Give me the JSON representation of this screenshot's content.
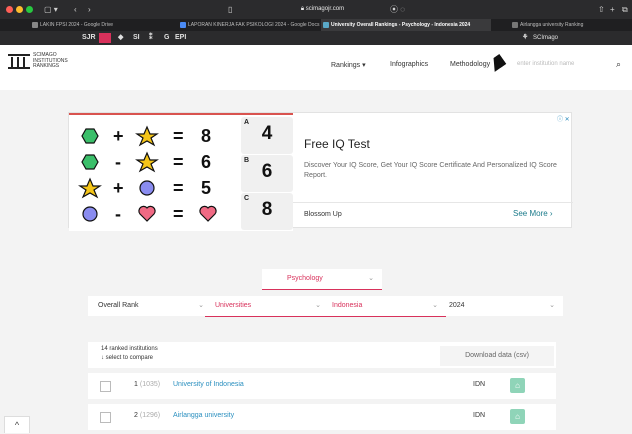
{
  "browser": {
    "address": "scimagojr.com",
    "tabs": [
      {
        "label": "LAKIN FPSI 2024 - Google Drive"
      },
      {
        "label": "LAPORAN KINERJA FAK PSIKOLOGI 2024 - Google Docs"
      },
      {
        "label": "University Overall Rankings - Psychology - Indonesia 2024"
      },
      {
        "label": "Airlangga university Ranking"
      }
    ],
    "bookmarks": [
      "SJR",
      "SI",
      "EPI"
    ],
    "right_bookmark": "SCImago",
    "colors": {
      "close": "#ff5f57",
      "min": "#febc2e",
      "max": "#28c840"
    }
  },
  "site": {
    "logo_lines": [
      "SCIMAGO",
      "INSTITUTIONS",
      "RANKINGS"
    ],
    "nav": {
      "rankings": "Rankings ▾",
      "infographics": "Infographics",
      "methodology": "Methodology"
    },
    "search_placeholder": "enter institution name",
    "accent": "#d8315b"
  },
  "ad": {
    "title": "Free IQ Test",
    "description": "Discover Your IQ Score, Get Your IQ Score Certificate And Personalized IQ Score Report.",
    "brand": "Blossom Up",
    "cta": "See More ›",
    "badge": "ⓘ ✕",
    "puzzle": {
      "rows": [
        {
          "a": "hexagon",
          "op": "+",
          "b": "star",
          "eq": "=",
          "result": "8"
        },
        {
          "a": "hexagon",
          "op": "-",
          "b": "star",
          "eq": "=",
          "result": "6"
        },
        {
          "a": "star",
          "op": "+",
          "b": "circle",
          "eq": "=",
          "result": "5"
        },
        {
          "a": "circle",
          "op": "-",
          "b": "heart",
          "eq": "=",
          "result": "heart"
        }
      ],
      "options": [
        {
          "label": "A",
          "value": "4"
        },
        {
          "label": "B",
          "value": "6"
        },
        {
          "label": "C",
          "value": "8"
        }
      ]
    }
  },
  "filters": {
    "subject": "Psychology",
    "rank_type": "Overall Rank",
    "sector": "Universities",
    "country": "Indonesia",
    "year": "2024"
  },
  "results": {
    "count_text": "14 ranked institutions",
    "select_hint": "↓ select to compare",
    "download": "Download data (csv)",
    "rows": [
      {
        "rank": "1",
        "world": "(1035)",
        "name": "University of Indonesia",
        "country": "IDN"
      },
      {
        "rank": "2",
        "world": "(1296)",
        "name": "Airlangga university",
        "country": "IDN"
      }
    ]
  }
}
